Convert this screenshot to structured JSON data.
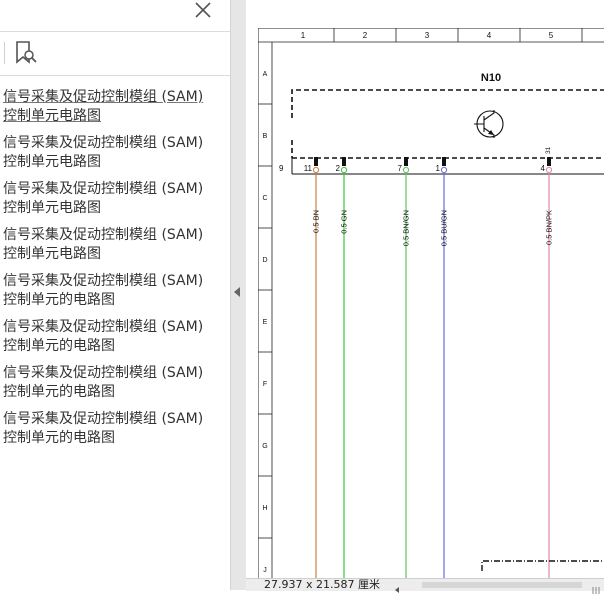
{
  "sidebar": {
    "bookmarks": [
      {
        "line1": "信号采集及促动控制模组 (SAM)",
        "line2": "控制单元电路图",
        "selected": true
      },
      {
        "line1": "信号采集及促动控制模组 (SAM)",
        "line2": "控制单元电路图"
      },
      {
        "line1": "信号采集及促动控制模组 (SAM)",
        "line2": "控制单元电路图"
      },
      {
        "line1": "信号采集及促动控制模组 (SAM)",
        "line2": "控制单元电路图"
      },
      {
        "line1": "信号采集及促动控制模组 (SAM)",
        "line2": "控制单元的电路图"
      },
      {
        "line1": "信号采集及促动控制模组 (SAM)",
        "line2": "控制单元的电路图"
      },
      {
        "line1": "信号采集及促动控制模组 (SAM)",
        "line2": "控制单元的电路图"
      },
      {
        "line1": "信号采集及促动控制模组 (SAM)",
        "line2": "控制单元的电路图"
      }
    ]
  },
  "diagram": {
    "columns": [
      "1",
      "2",
      "3",
      "4",
      "5"
    ],
    "rows": [
      "A",
      "B",
      "C",
      "D",
      "E",
      "F",
      "G",
      "H",
      "J"
    ],
    "component": "N10",
    "connector_label": "9",
    "upper_pin": "31",
    "wires": [
      {
        "pin": "11",
        "label": "0.5 BN",
        "color": "#c8843c"
      },
      {
        "pin": "2",
        "label": "0.5 GN",
        "color": "#3cc83c"
      },
      {
        "pin": "7",
        "label": "0.5 BN/GN",
        "color": "#5cc85c"
      },
      {
        "pin": "1",
        "label": "0.5 BU/GN",
        "color": "#6a6ae0"
      },
      {
        "pin": "4",
        "label": "0.5 BN/PK",
        "color": "#e08a9c"
      }
    ]
  },
  "statusbar": {
    "page_size": "27.937 x 21.587 厘米"
  }
}
